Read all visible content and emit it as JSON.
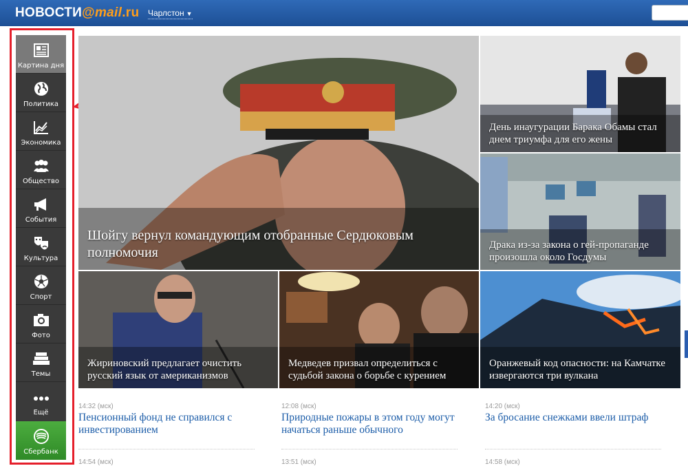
{
  "header": {
    "logo_main": "НОВОСТИ",
    "logo_at": "@",
    "logo_domain": "mail",
    "logo_tld": ".ru",
    "city": "Чарлстон"
  },
  "sidebar": {
    "items": [
      {
        "label": "Картина дня",
        "icon": "newspaper-icon"
      },
      {
        "label": "Политика",
        "icon": "globe-icon"
      },
      {
        "label": "Экономика",
        "icon": "chart-icon"
      },
      {
        "label": "Общество",
        "icon": "people-icon"
      },
      {
        "label": "События",
        "icon": "megaphone-icon"
      },
      {
        "label": "Культура",
        "icon": "theater-masks-icon"
      },
      {
        "label": "Спорт",
        "icon": "soccer-ball-icon"
      },
      {
        "label": "Фото",
        "icon": "camera-icon"
      },
      {
        "label": "Темы",
        "icon": "stack-icon"
      },
      {
        "label": "Ещё",
        "icon": "more-dots-icon"
      },
      {
        "label": "Сбербанк",
        "icon": "sberbank-logo-icon"
      }
    ]
  },
  "tiles": {
    "main": "Шойгу вернул командующим отобранные Сердюковым полномочия",
    "obama": "День инаугурации Барака Обамы стал днем триумфа для его жены",
    "fight": "Драка из-за закона о гей-пропаганде произошла около Госдумы",
    "zhirinovsky": "Жириновский предлагает очистить русский язык от американизмов",
    "medvedev": "Медведев призвал определиться с судьбой закона о борьбе с курением",
    "volcano": "Оранжевый код опасности: на Камчатке извергаются три вулкана"
  },
  "news": [
    {
      "time": "14:32 (мск)",
      "title": "Пенсионный фонд не справился с инвестированием"
    },
    {
      "time": "12:08 (мск)",
      "title": "Природные пожары в этом году могут начаться раньше обычного"
    },
    {
      "time": "14:20 (мск)",
      "title": "За бросание снежками ввели штраф"
    }
  ],
  "news_next": [
    {
      "time": "14:54 (мск)"
    },
    {
      "time": "13:51 (мск)"
    },
    {
      "time": "14:58 (мск)"
    }
  ],
  "colors": {
    "header_blue": "#1d4f95",
    "logo_orange": "#ff9e1a",
    "link_blue": "#1b5ca8",
    "annotation_red": "#e51f2b",
    "sidebar_dark": "#3a3a3a",
    "sberbank_green": "#3a9a2f"
  }
}
